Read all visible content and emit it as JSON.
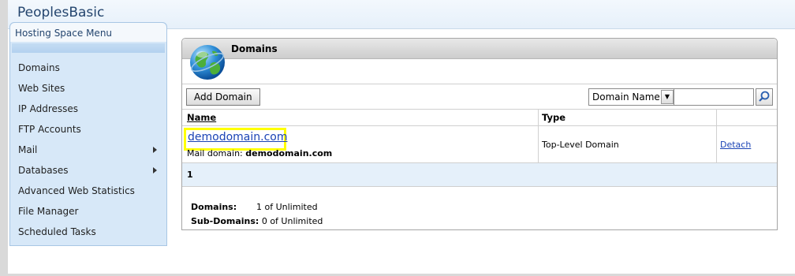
{
  "app": {
    "title": "PeoplesBasic"
  },
  "sidebar": {
    "title": "Hosting Space Menu",
    "items": [
      {
        "label": "Domains",
        "submenu": false
      },
      {
        "label": "Web Sites",
        "submenu": false
      },
      {
        "label": "IP Addresses",
        "submenu": false
      },
      {
        "label": "FTP Accounts",
        "submenu": false
      },
      {
        "label": "Mail",
        "submenu": true
      },
      {
        "label": "Databases",
        "submenu": true
      },
      {
        "label": "Advanced Web Statistics",
        "submenu": false
      },
      {
        "label": "File Manager",
        "submenu": false
      },
      {
        "label": "Scheduled Tasks",
        "submenu": false
      }
    ]
  },
  "panel": {
    "title": "Domains",
    "icon": "globe-icon",
    "toolbar": {
      "add_label": "Add Domain",
      "filter_selected": "Domain Name",
      "search_value": "",
      "search_icon": "magnifier-icon"
    },
    "table": {
      "columns": [
        "Name",
        "Type",
        ""
      ],
      "rows": [
        {
          "name": "demodomain.com",
          "mail_label": "Mail domain:",
          "mail_domain": "demodomain.com",
          "type": "Top-Level Domain",
          "action": "Detach"
        }
      ]
    },
    "pager": {
      "current": "1"
    },
    "quotas": [
      {
        "label": "Domains:",
        "value": "1 of Unlimited"
      },
      {
        "label": "Sub-Domains:",
        "value": "0 of Unlimited"
      }
    ]
  },
  "colors": {
    "link": "#1b44b5",
    "highlight": "#ffff00",
    "sidebar_bg": "#d7e8f8"
  }
}
